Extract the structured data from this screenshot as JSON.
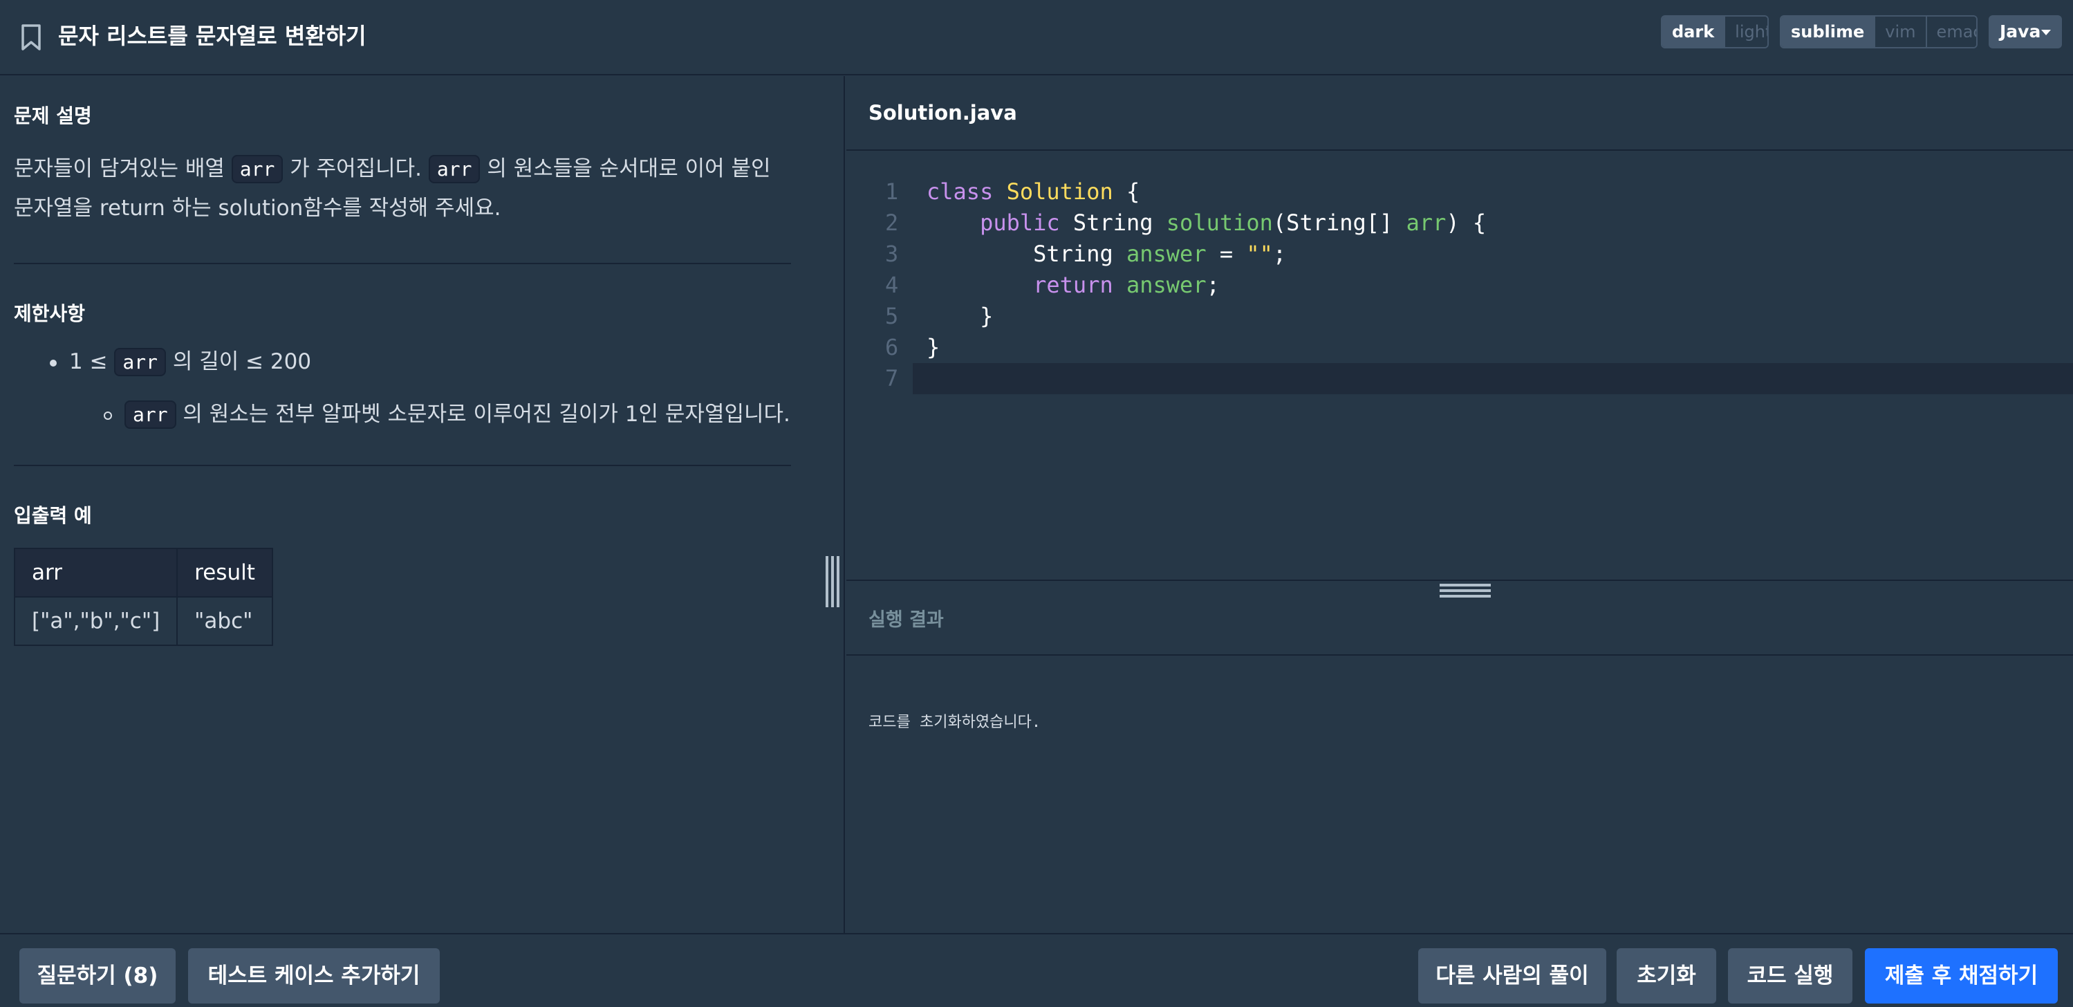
{
  "header": {
    "title": "문자 리스트를 문자열로 변환하기",
    "theme_options": [
      "dark",
      "light"
    ],
    "keymap_options": [
      "sublime",
      "vim",
      "emacs"
    ],
    "language": "Java"
  },
  "problem": {
    "description_title": "문제 설명",
    "description": {
      "part1": "문자들이 담겨있는 배열 ",
      "code1": "arr",
      "part2": " 가 주어집니다. ",
      "code2": "arr",
      "part3": " 의 원소들을 순서대로 이어 붙인 문자열을 return 하는 solution함수를 작성해 주세요."
    },
    "constraints_title": "제한사항",
    "constraint1": {
      "pre": "1 ≤ ",
      "code": "arr",
      "post": " 의 길이 ≤ 200"
    },
    "constraint2": {
      "code": "arr",
      "post": " 의 원소는 전부 알파벳 소문자로 이루어진 길이가 1인 문자열입니다."
    },
    "io_title": "입출력 예",
    "io_table": {
      "headers": [
        "arr",
        "result"
      ],
      "rows": [
        [
          "[\"a\",\"b\",\"c\"]",
          "\"abc\""
        ]
      ]
    }
  },
  "editor": {
    "filename": "Solution.java",
    "line_numbers": [
      "1",
      "2",
      "3",
      "4",
      "5",
      "6",
      "7"
    ],
    "tokens": {
      "l1_kw": "class",
      "l1_cls": "Solution",
      "l1_rest": " {",
      "l2_kw": "public",
      "l2_type": " String ",
      "l2_fn": "solution",
      "l2_p1": "(String[] ",
      "l2_arg": "arr",
      "l2_p2": ") {",
      "l3_type": "String ",
      "l3_var": "answer",
      "l3_eq": " = ",
      "l3_str": "\"\"",
      "l3_end": ";",
      "l4_kw": "return",
      "l4_sp": " ",
      "l4_var": "answer",
      "l4_end": ";",
      "l5": "}",
      "l6": "}"
    }
  },
  "output": {
    "title": "실행 결과",
    "text": "코드를 초기화하였습니다."
  },
  "footer": {
    "ask_label": "질문하기 (8)",
    "add_test_label": "테스트 케이스 추가하기",
    "others_label": "다른 사람의 풀이",
    "reset_label": "초기화",
    "run_label": "코드 실행",
    "submit_label": "제출 후 채점하기"
  }
}
